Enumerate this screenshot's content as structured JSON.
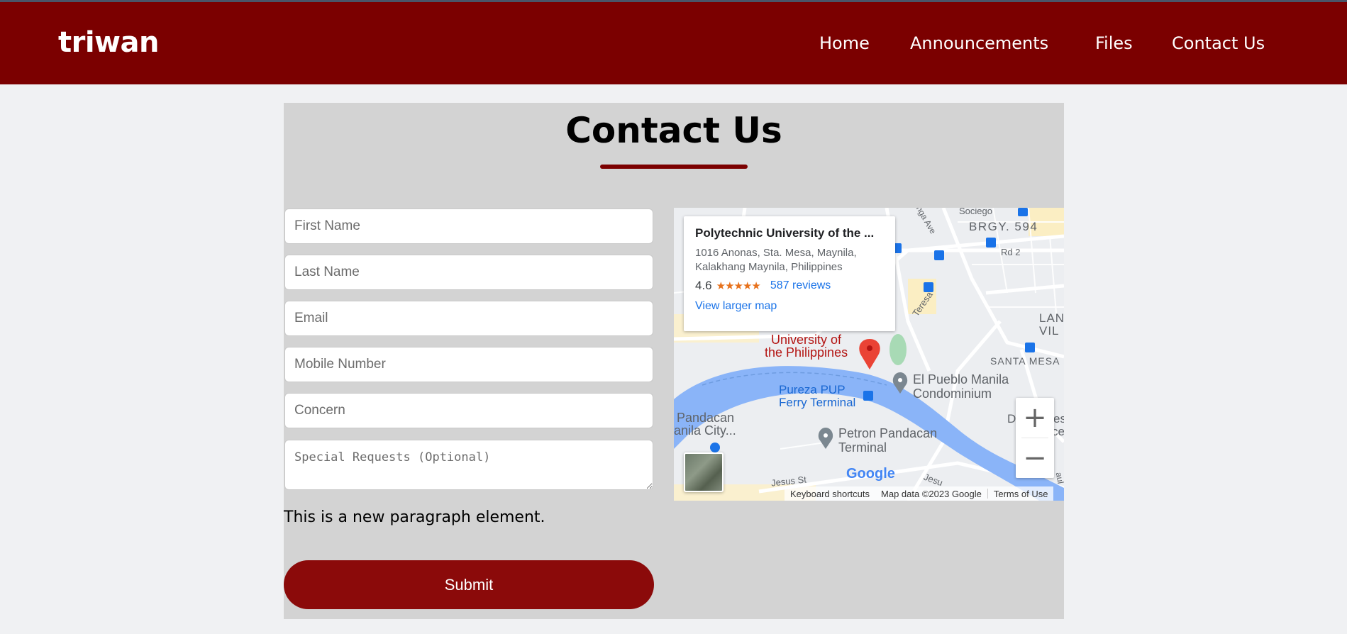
{
  "nav": {
    "brand": "triwan",
    "links": [
      "Home",
      "Announcements",
      "Files",
      "Contact Us"
    ]
  },
  "contact": {
    "title": "Contact Us",
    "fields": {
      "first_name": "First Name",
      "last_name": "Last Name",
      "email": "Email",
      "mobile": "Mobile Number",
      "concern": "Concern",
      "requests": "Special Requests (Optional)"
    },
    "paragraph": "This is a new paragraph element.",
    "submit_label": "Submit"
  },
  "map": {
    "place_name": "Polytechnic University of the ...",
    "address": "1016 Anonas, Sta. Mesa, Maynila, Kalakhang Maynila, Philippines",
    "rating": "4.6",
    "stars": "★★★★★",
    "reviews": "587 reviews",
    "larger_map": "View larger map",
    "labels": {
      "university": "University of",
      "university2": "the Philippines",
      "pureza": "Pureza PUP",
      "ferry": "Ferry Terminal",
      "pueblo": "El Pueblo Manila",
      "condominium": "Condominium",
      "petron": "Petron Pandacan",
      "terminal": "Terminal",
      "pandacan": "Pandacan",
      "manila_city": "anila City...",
      "brgy": "BRGY. 594",
      "sociego": "Sociego",
      "rd2": "Rd 2",
      "santa_mesa": "SANTA MESA",
      "lan": "LAN",
      "vil": "VIL",
      "dmc": "DMC",
      "res": "es",
      "rec": "ce",
      "jesus": "Jesus St",
      "jesu2": "Jesu",
      "teresa": "Teresa",
      "nga_ave": "nga Ave",
      "aul": "aul",
      "google": "Google"
    },
    "zoom_in": "+",
    "zoom_out": "−",
    "footer": {
      "shortcuts": "Keyboard shortcuts",
      "data": "Map data ©2023 Google",
      "terms": "Terms of Use"
    }
  },
  "colors": {
    "nav_bg": "#7b0000",
    "accent": "#8b0a0a",
    "panel_bg": "#d3d3d3",
    "page_bg": "#f0f1f3"
  }
}
